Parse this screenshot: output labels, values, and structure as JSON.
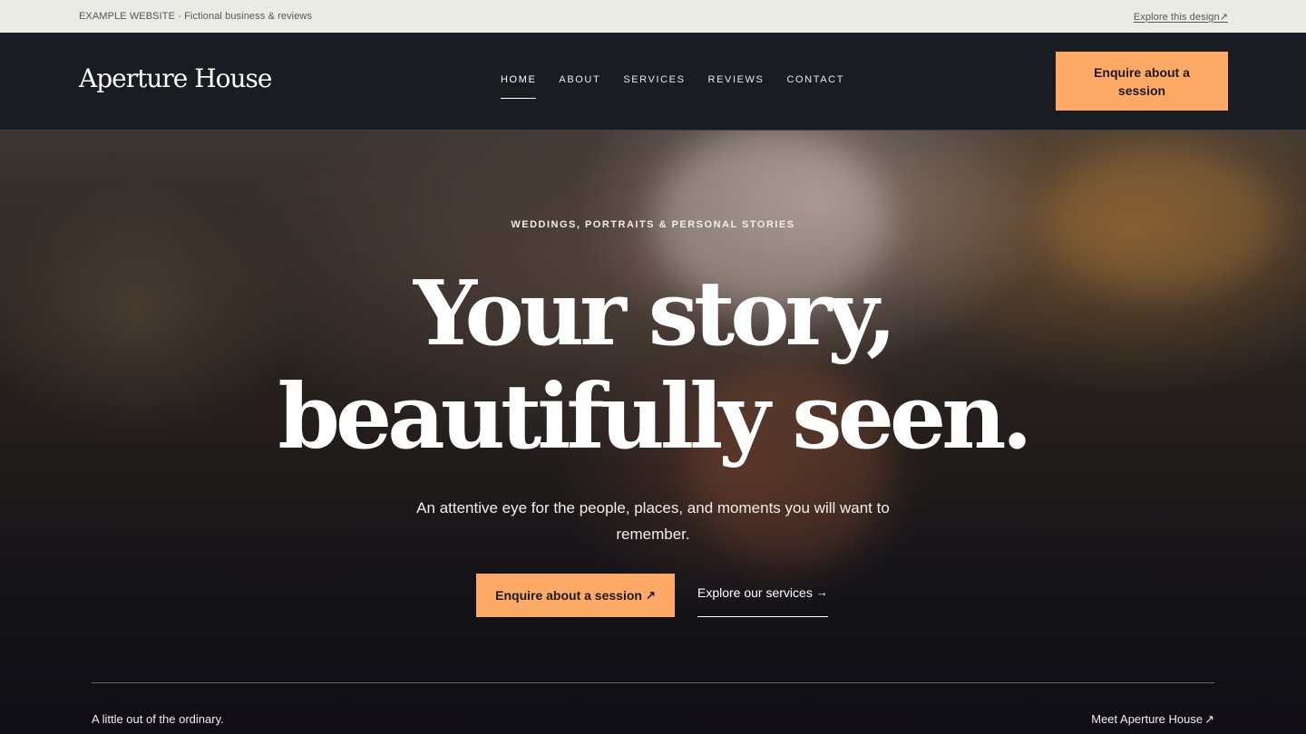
{
  "utility": {
    "left_text": "EXAMPLE WEBSITE · Fictional business & reviews",
    "right_link": "Explore this design",
    "right_icon": "↗"
  },
  "header": {
    "logo": "Aperture House",
    "nav": [
      {
        "label": "HOME",
        "active": true
      },
      {
        "label": "ABOUT",
        "active": false
      },
      {
        "label": "SERVICES",
        "active": false
      },
      {
        "label": "REVIEWS",
        "active": false
      },
      {
        "label": "CONTACT",
        "active": false
      }
    ],
    "cta_label": "Enquire about a session"
  },
  "hero": {
    "eyebrow": "WEDDINGS, PORTRAITS & PERSONAL STORIES",
    "title_line1": "Your story,",
    "title_line2": "beautifully seen.",
    "subtitle": "An attentive eye for the people, places, and moments you will want to remember.",
    "primary_cta": "Enquire about a session",
    "primary_cta_icon": "↗",
    "secondary_cta": "Explore our services",
    "secondary_cta_icon": "→",
    "footnote_left": "A little out of the ordinary.",
    "footnote_right": "Meet Aperture House",
    "footnote_right_icon": "↗"
  },
  "colors": {
    "accent": "#fea965",
    "header_bg": "#191c20",
    "utility_bg": "#ebebe6"
  }
}
